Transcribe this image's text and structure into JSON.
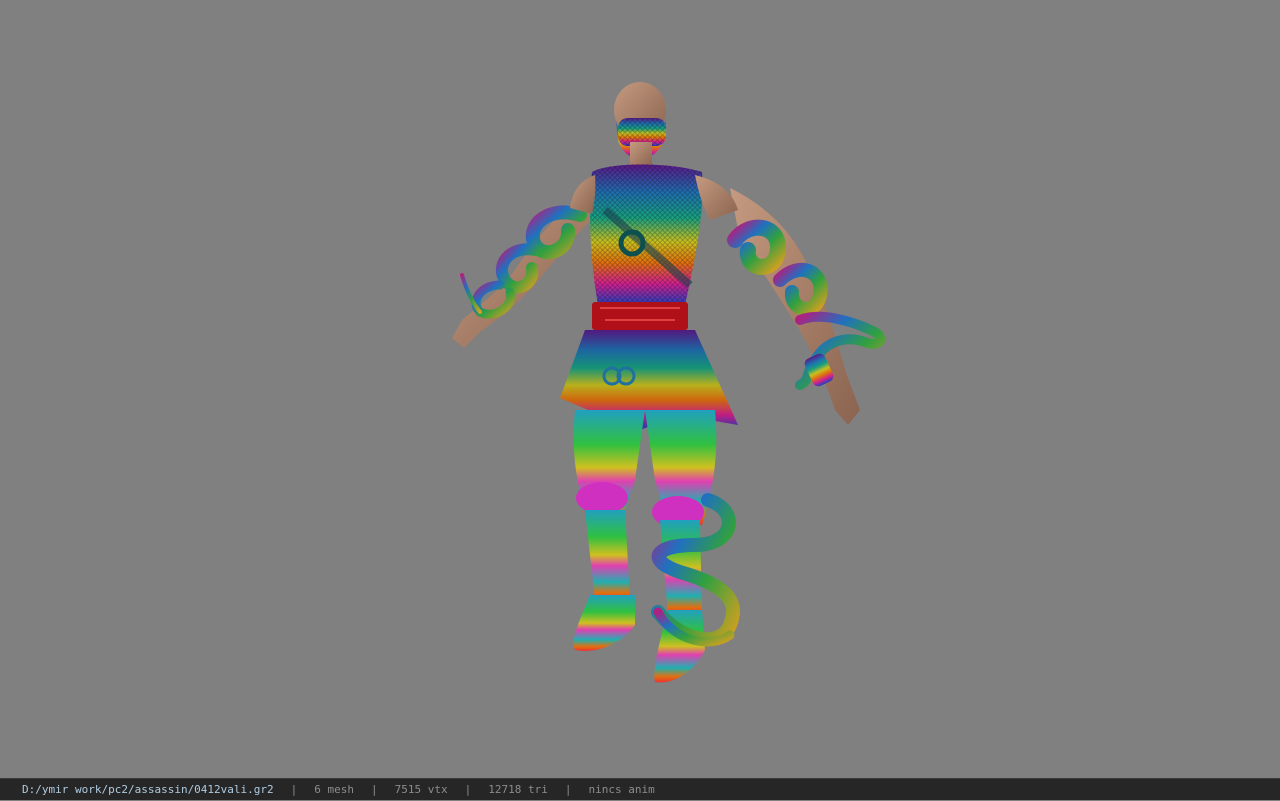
{
  "status_bar": {
    "file_path": "D:/ymir work/pc2/assassin/0412vali.gr2",
    "separator": "|",
    "mesh_count": "6 mesh",
    "vertex_count": "7515 vtx",
    "triangle_count": "12718 tri",
    "animation": "nincs anim"
  },
  "colors": {
    "background": "#808080",
    "status_bar_bg": "#262626",
    "status_text": "#8c8c8c",
    "path_text": "#aecbe0"
  }
}
